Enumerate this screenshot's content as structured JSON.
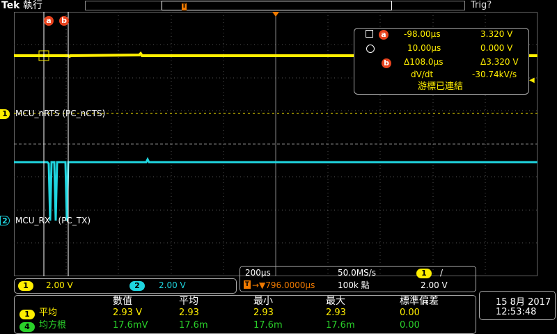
{
  "brand": {
    "name": "Tek",
    "mode": "執行"
  },
  "trigger_status": "Trig?",
  "trigger_position_icon": "T",
  "cursor_labels": {
    "a": "a",
    "b": "b"
  },
  "colors": {
    "ch1": "#ffee00",
    "ch2": "#1fd6e0",
    "math": "#2ad12a",
    "accent": "#e8431e",
    "trigger": "#f07a00"
  },
  "channels": {
    "ch1": {
      "number": "1",
      "label": "MCU_nRTS (PC_nCTS)",
      "scale": "2.00 V"
    },
    "ch2": {
      "number": "2",
      "label": "MCU_RX   (PC_TX)",
      "scale": "2.00 V"
    }
  },
  "cursor_readout": {
    "a_time": "-98.00µs",
    "a_volt": "3.320 V",
    "b_time": "10.00µs",
    "b_volt": "0.000 V",
    "delta_time": "Δ108.0µs",
    "delta_volt": "Δ3.320 V",
    "dvdt_label": "dV/dt",
    "dvdt_value": "-30.74kV/s",
    "linked_text": "游標已連結"
  },
  "horizontal": {
    "time_per_div": "200µs",
    "sample_rate": "50.0MS/s",
    "trigger_source": "1",
    "trigger_slope": "/",
    "trigger_icon": "T",
    "delay": "→▼796.0000µs",
    "record_length": "100k 點",
    "trigger_level": "2.00 V"
  },
  "measurements": {
    "headers": [
      "數值",
      "平均",
      "最小",
      "最大",
      "標準偏差"
    ],
    "rows": [
      {
        "source": "1",
        "name": "平均",
        "values": [
          "2.93 V",
          "2.93",
          "2.93",
          "2.93",
          "0.00"
        ]
      },
      {
        "source": "4",
        "name": "均方根",
        "values": [
          "17.6mV",
          "17.6m",
          "17.6m",
          "17.6m",
          "0.00"
        ]
      }
    ]
  },
  "clock": {
    "date": "15 8月 2017",
    "time": "12:53:48"
  }
}
